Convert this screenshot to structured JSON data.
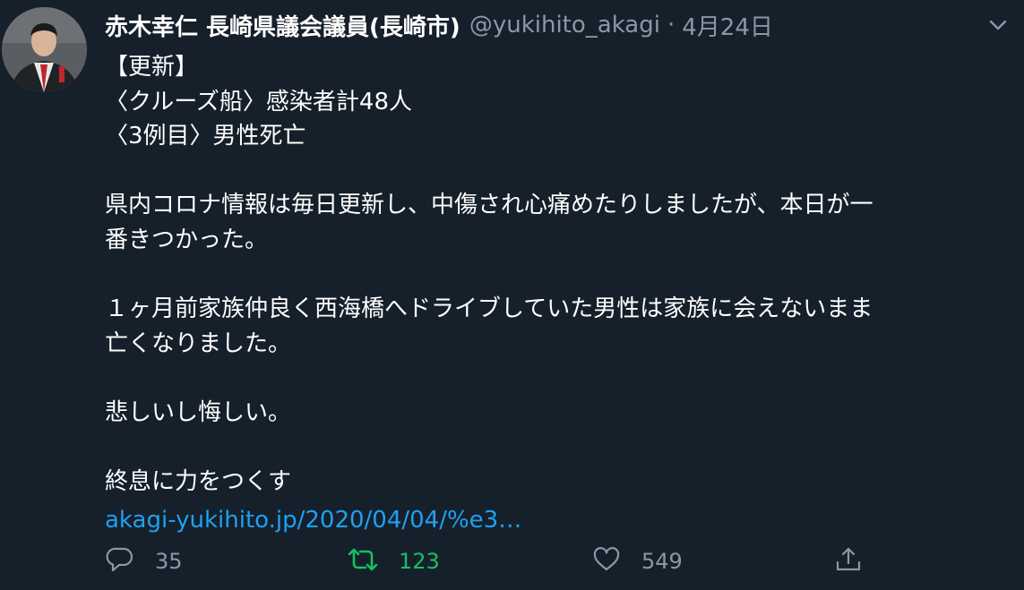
{
  "tweet": {
    "display_name": "赤木幸仁 長崎県議会議員(長崎市)",
    "handle": "@yukihito_akagi",
    "separator": "·",
    "date": "4月24日",
    "lines": [
      "【更新】",
      "〈クルーズ船〉感染者計48人",
      "〈3例目〉男性死亡",
      "",
      "県内コロナ情報は毎日更新し、中傷され心痛めたりしましたが、本日が一",
      "番きつかった。",
      "",
      "１ヶ月前家族仲良く西海橋へドライブしていた男性は家族に会えないまま",
      "亡くなりました。",
      "",
      "悲しいし悔しい。",
      "",
      "終息に力をつくす"
    ],
    "link_text": "akagi-yukihito.jp/2020/04/04/%e3…"
  },
  "actions": {
    "reply_count": "35",
    "retweet_count": "123",
    "like_count": "549"
  },
  "colors": {
    "background": "#15202b",
    "text": "#ffffff",
    "secondary": "#8899a6",
    "link": "#1da1f2",
    "retweeted": "#17bf63"
  },
  "icons": {
    "reply": "reply-icon",
    "retweet": "retweet-icon",
    "like": "heart-icon",
    "share": "share-icon",
    "menu": "chevron-down-icon"
  }
}
